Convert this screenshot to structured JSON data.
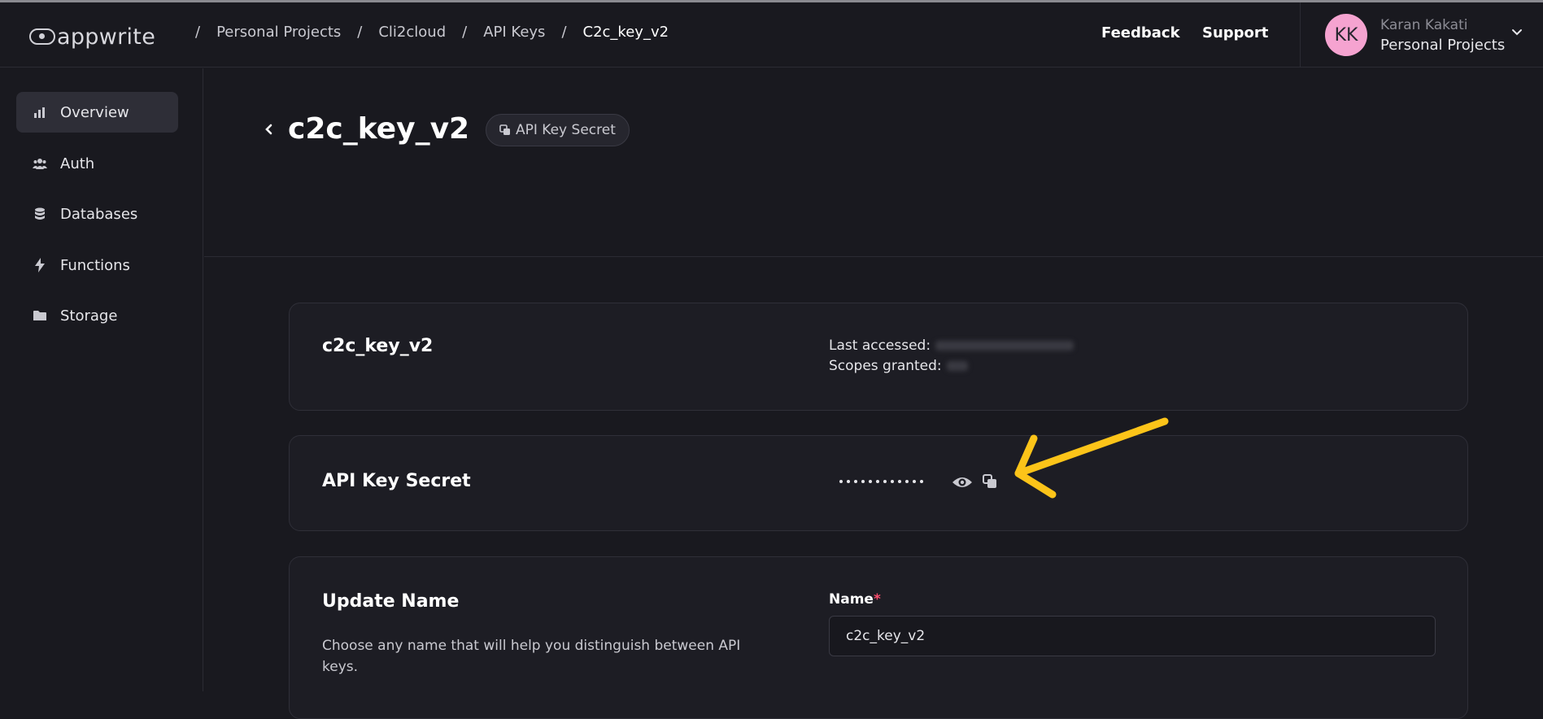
{
  "app": {
    "brand": "appwrite"
  },
  "breadcrumb": [
    "Personal Projects",
    "Cli2cloud",
    "API Keys",
    "C2c_key_v2"
  ],
  "header": {
    "feedback": "Feedback",
    "support": "Support"
  },
  "user": {
    "initials": "KK",
    "name": "Karan Kakati",
    "org": "Personal Projects"
  },
  "sidebar": {
    "items": [
      {
        "label": "Overview",
        "icon": "chart-icon",
        "active": true
      },
      {
        "label": "Auth",
        "icon": "users-icon"
      },
      {
        "label": "Databases",
        "icon": "database-icon"
      },
      {
        "label": "Functions",
        "icon": "lightning-icon"
      },
      {
        "label": "Storage",
        "icon": "folder-icon"
      }
    ]
  },
  "page": {
    "title": "c2c_key_v2",
    "secret_pill": "API Key Secret"
  },
  "key_card": {
    "name": "c2c_key_v2",
    "last_accessed_label": "Last accessed:",
    "scopes_label": "Scopes granted:"
  },
  "secret_card": {
    "title": "API Key Secret"
  },
  "update_card": {
    "title": "Update Name",
    "description": "Choose any name that will help you distinguish between API keys.",
    "field_label": "Name",
    "required_mark": "*",
    "value": "c2c_key_v2"
  },
  "colors": {
    "accent": "#f5a3d0",
    "annotation_arrow": "#fcc419",
    "required": "#ff4d6d"
  }
}
